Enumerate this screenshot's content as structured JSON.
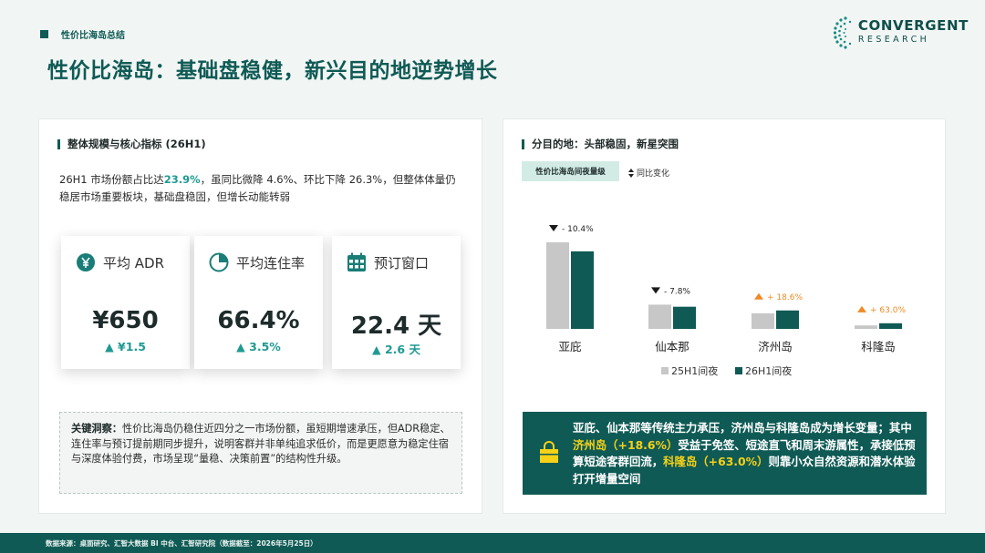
{
  "header": {
    "tag": "性价比海岛总结",
    "title": "性价比海岛：基础盘稳健，新兴目的地逆势增长",
    "brand_name": "CONVERGENT",
    "brand_sub": "RESEARCH"
  },
  "left": {
    "section_title": "整体规模与核心指标 (26H1)",
    "summary_prefix": "26H1 市场份额占比达",
    "summary_highlight": "23.9%",
    "summary_suffix": "，虽同比微降 4.6%、环比下降 26.3%，但整体体量仍稳居市场重要板块，基础盘稳固，但增长动能转弱",
    "metrics": [
      {
        "icon": "yen-circle-icon",
        "label": "平均 ADR",
        "value": "¥650",
        "delta": "▲ ¥1.5"
      },
      {
        "icon": "pie-chart-icon",
        "label": "平均连住率",
        "value": "66.4%",
        "delta": "▲ 3.5%"
      },
      {
        "icon": "calendar-icon",
        "label": "预订窗口",
        "value": "22.4 天",
        "delta": "▲ 2.6 天"
      }
    ],
    "insight_label": "关键洞察：",
    "insight_text": "性价比海岛仍稳住近四分之一市场份额，虽短期增速承压，但ADR稳定、连住率与预订提前期同步提升，说明客群并非单纯追求低价，而是更愿意为稳定住宿与深度体验付费，市场呈现“量稳、决策前置”的结构性升级。"
  },
  "right": {
    "section_title": "分目的地：头部稳固，新星突围",
    "pill": "性价比海岛间夜量级",
    "yoy_label": "同比变化",
    "colors": {
      "prev": "#c7c7c7",
      "curr": "#0f5a55",
      "up": "#f08a24",
      "down": "#1a1a1a"
    },
    "callout": {
      "line_a": "亚庇、仙本那等传统主力承压，济州岛与科隆岛成为增长变量；其中",
      "hl1": "济州岛（+18.6%）",
      "line_b": "受益于免签、短途直飞和周末游属性，承接低预算短途客群回流，",
      "hl2": "科隆岛（+63.0%）",
      "line_c": "则靠小众自然资源和潜水体验打开增量空间"
    }
  },
  "chart_data": {
    "type": "bar",
    "categories": [
      "亚庇",
      "仙本那",
      "济州岛",
      "科隆岛"
    ],
    "series": [
      {
        "name": "25H1间夜",
        "values": [
          100,
          28,
          18,
          4
        ]
      },
      {
        "name": "26H1间夜",
        "values": [
          89.6,
          25.6,
          21.3,
          6.5
        ]
      }
    ],
    "changes": [
      "- 10.4%",
      "- 7.8%",
      "+ 18.6%",
      "+ 63.0%"
    ],
    "change_direction": [
      "down",
      "down",
      "up",
      "up"
    ],
    "legend": [
      "25H1间夜",
      "26H1间夜"
    ],
    "legend_position": "bottom-right",
    "ylim": [
      0,
      100
    ],
    "grid": false
  },
  "footer": {
    "source": "数据来源：桌面研究、汇智大数据 BI 中台、汇智研究院（数据截至：2026年5月25日）"
  }
}
